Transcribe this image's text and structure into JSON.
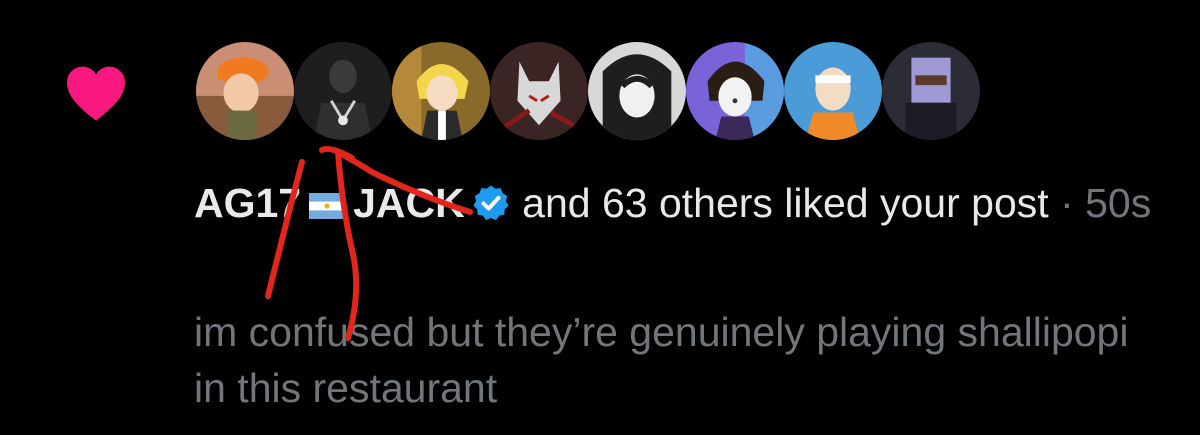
{
  "notification": {
    "type_icon": "heart-icon",
    "heart_color": "#f91880",
    "avatars": [
      {
        "name": "avatar-1",
        "bg": "#b9795a"
      },
      {
        "name": "avatar-2",
        "bg": "#2a2a2a"
      },
      {
        "name": "avatar-3",
        "bg": "#c8a640"
      },
      {
        "name": "avatar-4",
        "bg": "#5a2a2a"
      },
      {
        "name": "avatar-5",
        "bg": "#9a9a9a"
      },
      {
        "name": "avatar-6",
        "bg": "#6b55c8"
      },
      {
        "name": "avatar-7",
        "bg": "#4a8fd0"
      },
      {
        "name": "avatar-8",
        "bg": "#2e2e3a"
      }
    ],
    "user1": "AG17",
    "user2": "JACK",
    "flag_icon": "argentina-flag-icon",
    "verified_icon": "verified-badge-icon",
    "verified_color": "#1d9bf0",
    "others_text": "and 63 others liked your post",
    "separator": " · ",
    "time": "50s",
    "post_text": "im confused but they’re genuinely playing shallipopi in this restaurant"
  },
  "annotation": {
    "icon": "red-scribble-annotation",
    "color": "#e3261c"
  }
}
